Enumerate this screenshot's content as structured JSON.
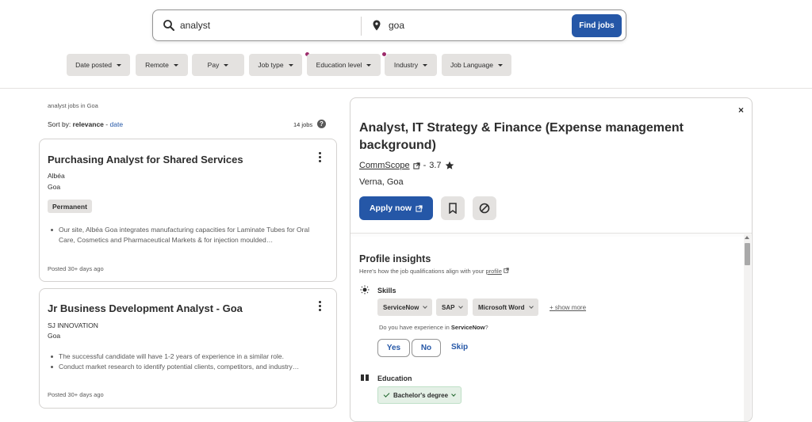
{
  "search": {
    "what_value": "analyst",
    "where_value": "goa",
    "find_button": "Find jobs"
  },
  "filters": [
    {
      "label": "Date posted",
      "active": false
    },
    {
      "label": "Remote",
      "active": false
    },
    {
      "label": "Pay",
      "active": false
    },
    {
      "label": "Job type",
      "active": true
    },
    {
      "label": "Education level",
      "active": false
    },
    {
      "label": "Industry",
      "active": true
    },
    {
      "label": "Job Language",
      "active": false
    }
  ],
  "results": {
    "heading": "analyst jobs in Goa",
    "sort_prefix": "Sort by:",
    "sort_active": "relevance",
    "sort_sep": "-",
    "sort_alt": "date",
    "count": "14 jobs",
    "help_icon": "?"
  },
  "jobs": [
    {
      "title": "Purchasing Analyst for Shared Services",
      "company": "Albéa",
      "location": "Goa",
      "badge": "Permanent",
      "snippet": [
        "Our site, Albéa Goa integrates manufacturing capacities for Laminate Tubes for Oral Care, Cosmetics and Pharmaceutical Markets & for injection moulded…"
      ],
      "posted": "Posted 30+ days ago"
    },
    {
      "title": "Jr Business Development Analyst - Goa",
      "company": "SJ INNOVATION",
      "location": "Goa",
      "snippet": [
        "The successful candidate will have 1-2 years of experience in a similar role.",
        "Conduct market research to identify potential clients, competitors, and industry…"
      ],
      "posted": "Posted 30+ days ago"
    }
  ],
  "detail": {
    "close": "×",
    "title": "Analyst, IT Strategy & Finance (Expense management background)",
    "company": "CommScope",
    "sep": "-",
    "rating": "3.7",
    "location": "Verna, Goa",
    "apply_label": "Apply now",
    "profile_insights": {
      "title": "Profile insights",
      "subtitle": "Here's how the job qualifications align with your",
      "profile_link": "profile",
      "skills_label": "Skills",
      "skills": [
        "ServiceNow",
        "SAP",
        "Microsoft Word"
      ],
      "show_more": "+ show more",
      "question_prefix": "Do you have experience in",
      "question_skill": "ServiceNow",
      "question_suffix": "?",
      "yes": "Yes",
      "no": "No",
      "skip": "Skip",
      "education_label": "Education",
      "education_value": "Bachelor's degree"
    }
  },
  "colors": {
    "primary": "#2557a7",
    "chip_bg": "#e4e2e0",
    "filter_dot": "#9d2b6b",
    "education_chip": "#e4f0e6"
  }
}
